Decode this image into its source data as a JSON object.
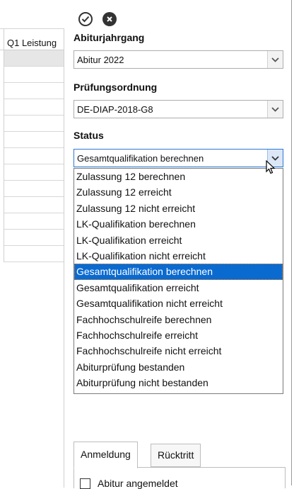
{
  "grid": {
    "column_header": "Q1 Leistung",
    "row_count": 13
  },
  "toolbar": {
    "confirm_icon": "check-circle-icon",
    "cancel_icon": "x-circle-icon"
  },
  "fields": {
    "abiturjahrgang": {
      "label": "Abiturjahrgang",
      "value": "Abitur 2022"
    },
    "pruefungsordnung": {
      "label": "Prüfungsordnung",
      "value": "DE-DIAP-2018-G8"
    },
    "status": {
      "label": "Status",
      "value": "Gesamtqualifikation berechnen",
      "options": [
        "Zulassung 12 berechnen",
        "Zulassung 12 erreicht",
        "Zulassung 12 nicht erreicht",
        "LK-Qualifikation berechnen",
        "LK-Qualifikation erreicht",
        "LK-Qualifikation nicht erreicht",
        "Gesamtqualifikation berechnen",
        "Gesamtqualifikation erreicht",
        "Gesamtqualifikation nicht erreicht",
        "Fachhochschulreife berechnen",
        "Fachhochschulreife erreicht",
        "Fachhochschulreife nicht erreicht",
        "Abiturprüfung bestanden",
        "Abiturprüfung nicht bestanden"
      ],
      "highlighted": "Gesamtqualifikation berechnen"
    }
  },
  "tabs": [
    {
      "label": "Anmeldung",
      "active": true
    },
    {
      "label": "Rücktritt",
      "active": false
    }
  ],
  "tab_content": {
    "checkbox_label": "Abitur angemeldet"
  },
  "colors": {
    "highlight": "#0a6ad0",
    "focus_border": "#2d78d4"
  }
}
